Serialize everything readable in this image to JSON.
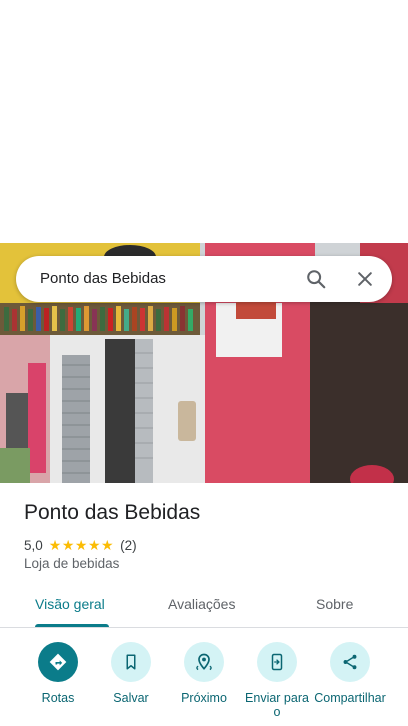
{
  "search": {
    "query": "Ponto das Bebidas",
    "search_icon": "search-icon",
    "close_icon": "close-icon"
  },
  "place": {
    "name": "Ponto das Bebidas",
    "rating": "5,0",
    "rating_stars": 5,
    "review_count": "(2)",
    "category": "Loja de bebidas"
  },
  "tabs": [
    {
      "label": "Visão geral",
      "active": true
    },
    {
      "label": "Avaliações",
      "active": false
    },
    {
      "label": "Sobre",
      "active": false
    }
  ],
  "actions": [
    {
      "label": "Rotas",
      "icon": "directions-icon"
    },
    {
      "label": "Salvar",
      "icon": "bookmark-icon"
    },
    {
      "label": "Próximo",
      "icon": "nearby-icon"
    },
    {
      "label": "Enviar para o",
      "icon": "send-to-phone-icon"
    },
    {
      "label": "Compartilhar",
      "icon": "share-icon"
    }
  ],
  "colors": {
    "accent": "#0b7c8a",
    "chip_bg": "#d4f3f5",
    "star": "#fbbc04"
  }
}
